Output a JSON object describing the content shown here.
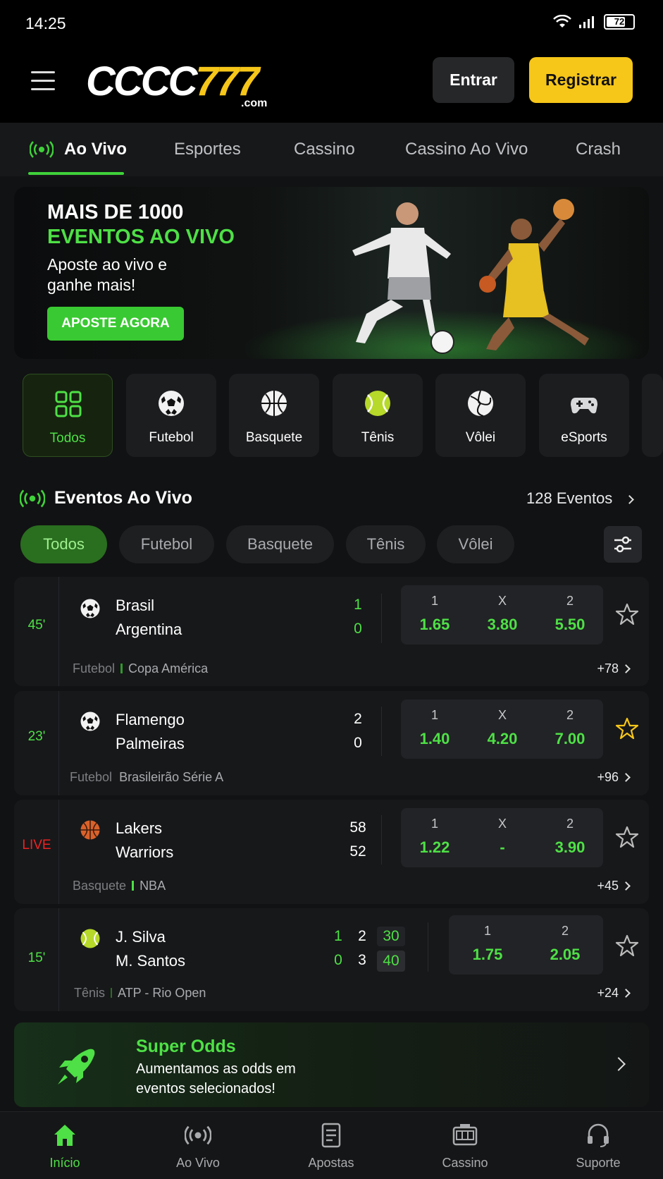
{
  "status": {
    "time": "14:25",
    "battery": "72"
  },
  "header": {
    "logo_main": "CCCC",
    "logo_accent": "777",
    "logo_suffix": ".com",
    "login_label": "Entrar",
    "register_label": "Registrar"
  },
  "nav_tabs": [
    {
      "label": "Ao Vivo",
      "active": true
    },
    {
      "label": "Esportes"
    },
    {
      "label": "Cassino"
    },
    {
      "label": "Cassino Ao Vivo"
    },
    {
      "label": "Crash"
    }
  ],
  "banner": {
    "line1": "MAIS DE 1000",
    "line2": "EVENTOS AO VIVO",
    "line3": "Aposte ao vivo e ganhe mais!",
    "cta": "APOSTE AGORA"
  },
  "sports": [
    {
      "label": "Todos",
      "icon": "grid-icon",
      "active": true
    },
    {
      "label": "Futebol",
      "icon": "soccer-ball-icon"
    },
    {
      "label": "Basquete",
      "icon": "basketball-icon"
    },
    {
      "label": "Tênis",
      "icon": "tennis-ball-icon"
    },
    {
      "label": "Vôlei",
      "icon": "volleyball-icon"
    },
    {
      "label": "eSports",
      "icon": "gamepad-icon"
    }
  ],
  "live_events": {
    "title": "Eventos Ao Vivo",
    "count": "128 Eventos"
  },
  "filters": [
    {
      "label": "Todos",
      "active": true
    },
    {
      "label": "Futebol"
    },
    {
      "label": "Basquete"
    },
    {
      "label": "Tênis"
    },
    {
      "label": "Vôlei"
    }
  ],
  "matches": [
    {
      "time": "45'",
      "sport": "Futebol",
      "competition": "Copa América",
      "more": "+78",
      "team1": "Brasil",
      "team2": "Argentina",
      "score1": "1",
      "score2": "0",
      "odds": [
        {
          "h": "1",
          "v": "1.65"
        },
        {
          "h": "X",
          "v": "3.80"
        },
        {
          "h": "2",
          "v": "5.50"
        }
      ],
      "favorite": false
    },
    {
      "time": "23'",
      "sport": "Futebol",
      "competition": "Brasileirão Série A",
      "more": "+96",
      "team1": "Flamengo",
      "team2": "Palmeiras",
      "score1": "2",
      "score2": "0",
      "odds": [
        {
          "h": "1",
          "v": "1.40"
        },
        {
          "h": "X",
          "v": "4.20"
        },
        {
          "h": "2",
          "v": "7.00"
        }
      ],
      "favorite": true
    },
    {
      "time": "LIVE",
      "sport": "Basquete",
      "competition": "NBA",
      "more": "+45",
      "team1": "Lakers",
      "team2": "Warriors",
      "score1": "58",
      "score2": "52",
      "odds": [
        {
          "h": "1",
          "v": "1.22"
        },
        {
          "h": "X",
          "v": "-"
        },
        {
          "h": "2",
          "v": "3.90"
        }
      ],
      "favorite": false
    },
    {
      "time": "15'",
      "sport": "Tênis",
      "competition": "ATP - Rio Open",
      "more": "+24",
      "team1": "J. Silva",
      "team2": "M. Santos",
      "sets1": [
        "1",
        "2",
        "30"
      ],
      "sets2": [
        "0",
        "3",
        "40"
      ],
      "odds": [
        {
          "h": "1",
          "v": "1.75"
        },
        {
          "h": "2",
          "v": "2.05"
        }
      ],
      "favorite": false
    }
  ],
  "super_odds": {
    "title": "Super Odds",
    "subtitle": "Aumentamos as odds em eventos selecionados!"
  },
  "bottom_nav": [
    {
      "label": "Início",
      "icon": "home-icon",
      "active": true
    },
    {
      "label": "Ao Vivo",
      "icon": "live-icon"
    },
    {
      "label": "Apostas",
      "icon": "betslip-icon"
    },
    {
      "label": "Cassino",
      "icon": "slot-machine-icon"
    },
    {
      "label": "Suporte",
      "icon": "headset-icon"
    }
  ],
  "colors": {
    "accent_green": "#4ee046",
    "accent_yellow": "#f6c619",
    "live_red": "#e22222",
    "background": "#111213"
  }
}
